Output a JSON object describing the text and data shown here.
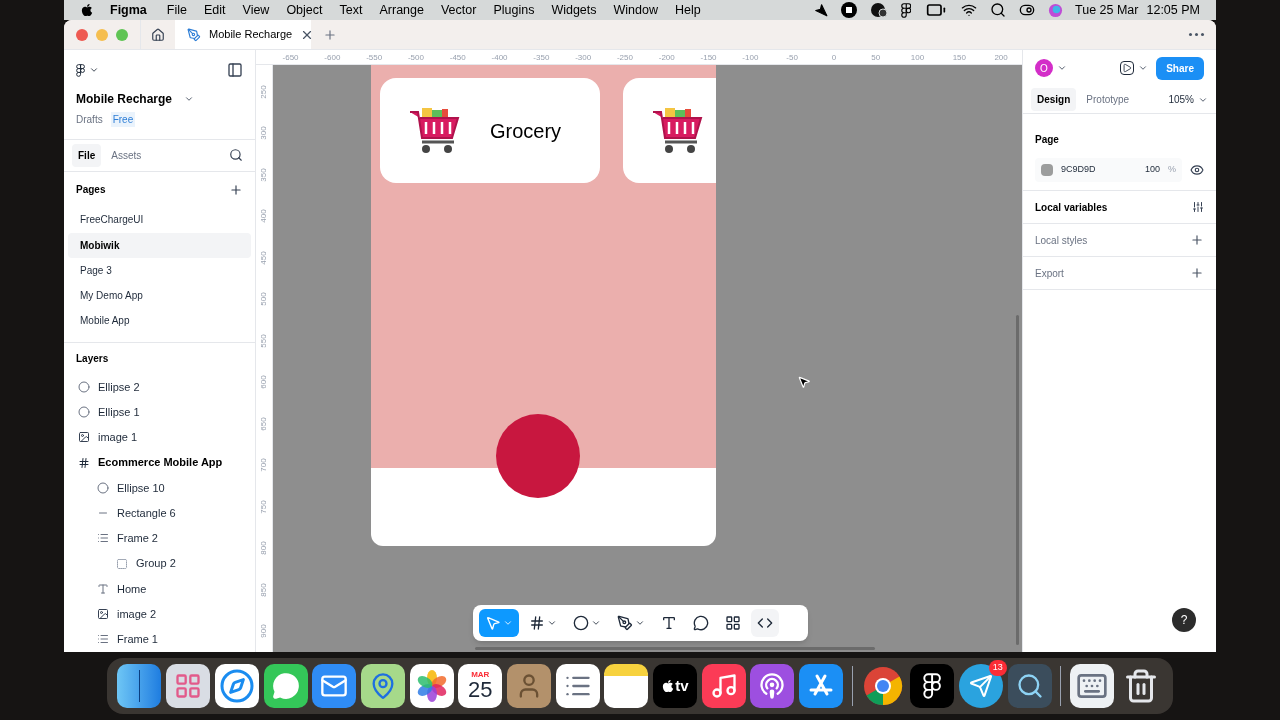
{
  "menu_bar": {
    "app": "Figma",
    "menus": [
      "File",
      "Edit",
      "View",
      "Object",
      "Text",
      "Arrange",
      "Vector",
      "Plugins",
      "Widgets",
      "Window",
      "Help"
    ],
    "status_icons": [
      {
        "kind": "location"
      },
      {
        "kind": "stop"
      },
      {
        "kind": "bubble"
      },
      {
        "kind": "figma"
      },
      {
        "kind": "battery"
      },
      {
        "kind": "wifi"
      },
      {
        "kind": "search"
      },
      {
        "kind": "control"
      },
      {
        "kind": "siri"
      }
    ],
    "date": "Tue 25 Mar",
    "time": "12:05 PM"
  },
  "tabs": [
    {
      "title": "Mobile Recharge",
      "selected": true
    }
  ],
  "left_panel": {
    "file_name": "Mobile Recharge",
    "location": "Drafts",
    "plan": "Free",
    "panel_tabs": [
      {
        "label": "File",
        "selected": true
      },
      {
        "label": "Assets",
        "selected": false
      }
    ],
    "pages_heading": "Pages",
    "pages": [
      {
        "name": "FreeChargeUI",
        "selected": false
      },
      {
        "name": "Mobiwik",
        "selected": true
      },
      {
        "name": "Page 3",
        "selected": false
      },
      {
        "name": "My Demo App",
        "selected": false
      },
      {
        "name": "Mobile App",
        "selected": false
      }
    ],
    "layers_heading": "Layers",
    "layers": [
      {
        "name": "Ellipse 2",
        "kind": "ellipse"
      },
      {
        "name": "Ellipse 1",
        "kind": "ellipse"
      },
      {
        "name": "image 1",
        "kind": "image"
      },
      {
        "name": "Ecommerce Mobile App",
        "kind": "frame",
        "children": [
          {
            "name": "Ellipse 10",
            "kind": "ellipse"
          },
          {
            "name": "Rectangle 6",
            "kind": "rectangle"
          },
          {
            "name": "Frame 2",
            "kind": "autolayout",
            "children": [
              {
                "name": "Group 2",
                "kind": "group"
              }
            ]
          },
          {
            "name": "Home",
            "kind": "text"
          },
          {
            "name": "image 2",
            "kind": "image"
          },
          {
            "name": "Frame 1",
            "kind": "autolayout"
          }
        ]
      }
    ]
  },
  "canvas": {
    "x_ruler": [
      "-650",
      "-600",
      "-550",
      "-500",
      "-450",
      "-400",
      "-350",
      "-300",
      "-250",
      "-200",
      "-150",
      "-100",
      "-50",
      "0",
      "50",
      "100",
      "150",
      "200"
    ],
    "y_ruler": [
      "250",
      "300",
      "350",
      "400",
      "450",
      "500",
      "550",
      "600",
      "650",
      "700",
      "750",
      "800",
      "850",
      "900"
    ],
    "cards": [
      {
        "kind": "labeled",
        "label": "Grocery"
      },
      {
        "kind": "clipped"
      }
    ],
    "toolbar": [
      {
        "kind": "move",
        "selected": true
      },
      {
        "kind": "frame",
        "selected": false
      },
      {
        "kind": "shape",
        "selected": false
      },
      {
        "kind": "pen",
        "selected": false
      },
      {
        "kind": "text",
        "selected": false
      },
      {
        "kind": "comment",
        "selected": false
      },
      {
        "kind": "actions",
        "selected": false
      },
      {
        "kind": "dev",
        "selected": false
      }
    ],
    "help": "?"
  },
  "right_panel": {
    "avatar": "O",
    "share": "Share",
    "tabs": [
      {
        "label": "Design",
        "selected": true
      },
      {
        "label": "Prototype",
        "selected": false
      }
    ],
    "zoom": "105%",
    "page_heading": "Page",
    "page_color": "9C9D9D",
    "opacity": "100",
    "percent": "%",
    "sections": [
      {
        "label": "Local variables",
        "kind": "variables"
      },
      {
        "label": "Local styles",
        "kind": "add"
      },
      {
        "label": "Export",
        "kind": "add"
      }
    ]
  },
  "dock": [
    {
      "kind": "finder"
    },
    {
      "kind": "launchpad"
    },
    {
      "kind": "safari"
    },
    {
      "kind": "messages"
    },
    {
      "kind": "mail"
    },
    {
      "kind": "maps"
    },
    {
      "kind": "photos"
    },
    {
      "kind": "calendar",
      "month": "MAR",
      "day": "25"
    },
    {
      "kind": "contacts"
    },
    {
      "kind": "reminders"
    },
    {
      "kind": "notes"
    },
    {
      "kind": "tv",
      "label": "tv"
    },
    {
      "kind": "music"
    },
    {
      "kind": "podcasts"
    },
    {
      "kind": "appstore"
    },
    {
      "kind": "divider"
    },
    {
      "kind": "chrome"
    },
    {
      "kind": "figma"
    },
    {
      "kind": "telegram",
      "badge": "13"
    },
    {
      "kind": "quicktime"
    },
    {
      "kind": "divider"
    },
    {
      "kind": "keyboard"
    },
    {
      "kind": "trash"
    }
  ]
}
